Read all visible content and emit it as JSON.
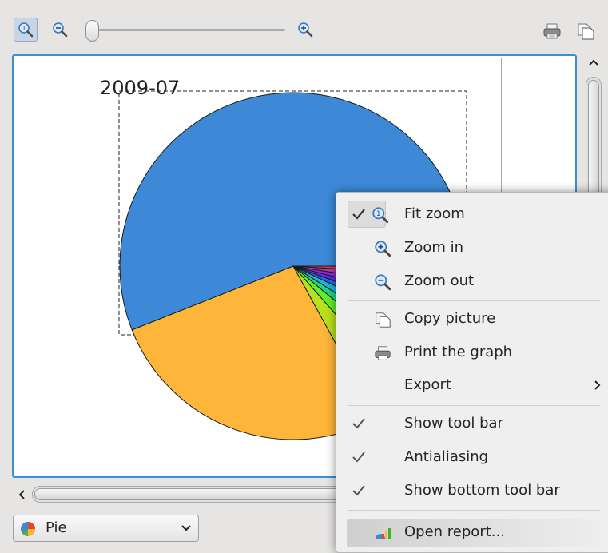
{
  "chart_data": {
    "type": "pie",
    "title": "2009-07",
    "slices": [
      {
        "label": "",
        "value": 56,
        "color": "#3d89d8"
      },
      {
        "label": "",
        "value": 27,
        "color": "#fdb53a"
      },
      {
        "label": "",
        "value": 3.5,
        "color": "#b7e11b"
      },
      {
        "label": "",
        "value": 2.5,
        "color": "#5ff028"
      },
      {
        "label": "",
        "value": 2,
        "color": "#1fd48a"
      },
      {
        "label": "",
        "value": 2,
        "color": "#1ab8d8"
      },
      {
        "label": "",
        "value": 1.5,
        "color": "#2a64e4"
      },
      {
        "label": "",
        "value": 1.5,
        "color": "#5b2ee0"
      },
      {
        "label": "",
        "value": 1.5,
        "color": "#8a2bd6"
      },
      {
        "label": "",
        "value": 1.5,
        "color": "#b03aa6"
      },
      {
        "label": "",
        "value": 1,
        "color": "#d63b5c"
      }
    ]
  },
  "toolbar": {
    "fit_zoom_icon": "zoom-fit-icon",
    "zoom_out_icon": "zoom-out-icon",
    "zoom_in_icon": "zoom-in-icon",
    "print_icon": "printer-icon",
    "copy_icon": "copy-icon",
    "zoom_slider_level": 0
  },
  "bottom": {
    "chart_type": "Pie",
    "chart_type_icon": "pie-chart-icon"
  },
  "menu": {
    "items": [
      {
        "label": "Fit zoom",
        "icon": "zoom-fit-icon",
        "checked": true
      },
      {
        "label": "Zoom in",
        "icon": "zoom-in-icon",
        "checked": false
      },
      {
        "label": "Zoom out",
        "icon": "zoom-out-icon",
        "checked": false
      },
      {
        "label": "Copy picture",
        "icon": "copy-icon",
        "checked": false
      },
      {
        "label": "Print the graph",
        "icon": "printer-icon",
        "checked": false
      },
      {
        "label": "Export",
        "icon": "",
        "checked": false,
        "submenu": true
      },
      {
        "label": "Show tool bar",
        "icon": "",
        "checked": true
      },
      {
        "label": "Antialiasing",
        "icon": "",
        "checked": true
      },
      {
        "label": "Show bottom tool bar",
        "icon": "",
        "checked": true
      },
      {
        "label": "Open report...",
        "icon": "report-icon",
        "checked": false
      }
    ]
  },
  "colors": {
    "accent": "#3a8fd6",
    "background": "#e6e5e4"
  }
}
